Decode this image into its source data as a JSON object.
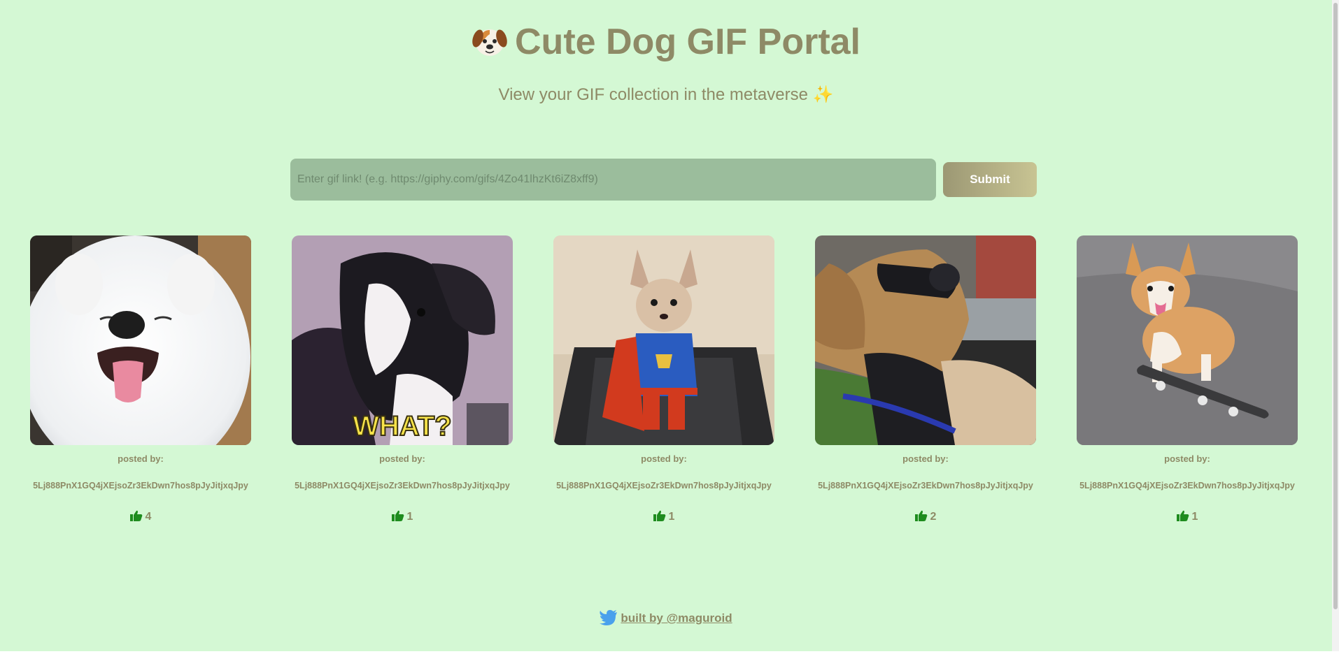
{
  "header": {
    "title": "Cute Dog GIF Portal",
    "subtitle": "View your GIF collection in the metaverse",
    "title_icon": "dog-face-icon",
    "subtitle_icon": "sparkles-icon"
  },
  "form": {
    "placeholder": "Enter gif link! (e.g. https://giphy.com/gifs/4Zo41lhzKt6iZ8xff9)",
    "value": "",
    "submit_label": "Submit"
  },
  "gifs": [
    {
      "image_desc": "white fluffy samoyed smiling",
      "posted_by_label": "posted by:",
      "address": "5Lj888PnX1GQ4jXEjsoZr3EkDwn7hos8pJyJitjxqJpy",
      "likes": "4"
    },
    {
      "image_desc": "black and white dog looking confused",
      "caption": "WHAT?",
      "posted_by_label": "posted by:",
      "address": "5Lj888PnX1GQ4jXEjsoZr3EkDwn7hos8pJyJitjxqJpy",
      "likes": "1"
    },
    {
      "image_desc": "chihuahua in superman costume on treadmill",
      "posted_by_label": "posted by:",
      "address": "5Lj888PnX1GQ4jXEjsoZr3EkDwn7hos8pJyJitjxqJpy",
      "likes": "1"
    },
    {
      "image_desc": "golden retriever wearing sunglasses driving",
      "posted_by_label": "posted by:",
      "address": "5Lj888PnX1GQ4jXEjsoZr3EkDwn7hos8pJyJitjxqJpy",
      "likes": "2"
    },
    {
      "image_desc": "corgi riding a skateboard",
      "posted_by_label": "posted by:",
      "address": "5Lj888PnX1GQ4jXEjsoZr3EkDwn7hos8pJyJitjxqJpy",
      "likes": "1"
    }
  ],
  "footer": {
    "icon": "twitter-bird-icon",
    "link_text": "built by @maguroid"
  },
  "colors": {
    "background": "#d4f8d4",
    "text": "#8e8a66",
    "input_bg": "#9bbd9c",
    "like_icon": "#1e8c1e",
    "twitter": "#4aa1ec"
  }
}
